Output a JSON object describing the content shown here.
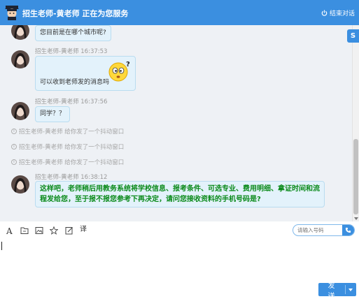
{
  "header": {
    "title": "招生老师-黄老师 正在为您服务",
    "end_label": "结束对话",
    "bg_color": "#3b8fe0"
  },
  "side_button": {
    "label": "S",
    "icon": "service-icon"
  },
  "messages": [
    {
      "meta": "",
      "text": "您目前是在哪个城市呢?"
    },
    {
      "meta": "招生老师-黄老师 16:37:53",
      "text": "可以收到老师发的消息吗",
      "emoji": "?"
    },
    {
      "meta": "招生老师-黄老师 16:37:56",
      "text": "同学？？"
    },
    {
      "meta": "招生老师-黄老师 16:38:12",
      "text": "这样吧，老师稍后用教务系统将学校信息、报考条件、可选专业、费用明细、拿证时间和流程发给您，至于报不报您参考下再决定，请问您接收资料的手机号码是?"
    }
  ],
  "system_notices": [
    "招生老师-黄老师 给你发了一个抖动窗口",
    "招生老师-黄老师 给你发了一个抖动窗口",
    "招生老师-黄老师 给你发了一个抖动窗口"
  ],
  "toolbar": {
    "items": [
      "font-icon",
      "folder-icon",
      "image-icon",
      "star-icon",
      "edit-icon",
      "translate-icon"
    ],
    "translate_glyph": "译",
    "phone_placeholder": "请输入号码"
  },
  "composer": {
    "value": ""
  },
  "send": {
    "label": "发 送"
  }
}
